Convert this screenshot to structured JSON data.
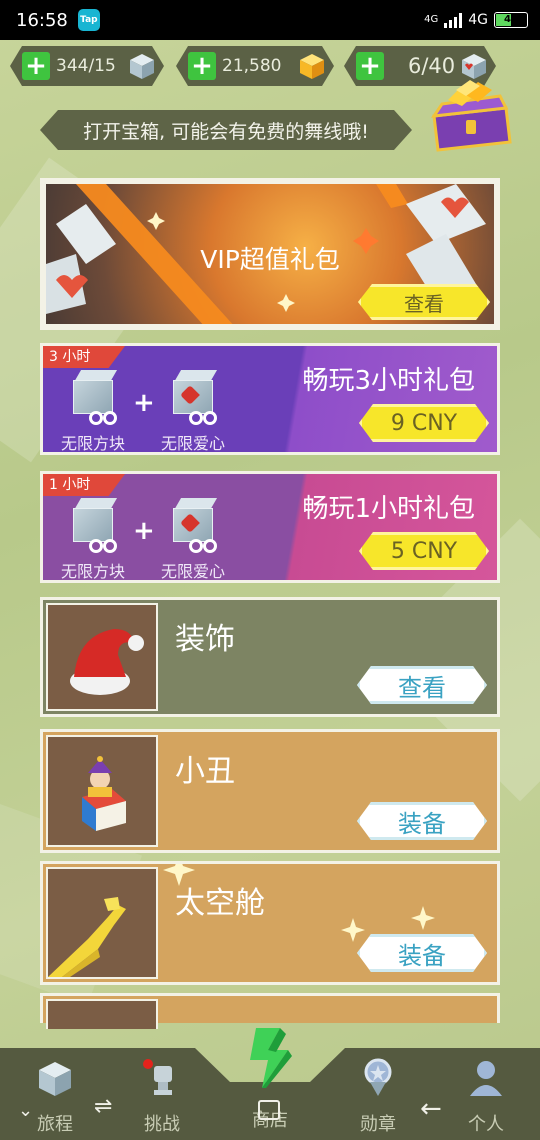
{
  "status_bar": {
    "time": "16:58",
    "app_icon_text": "Tap",
    "network_small": "4G",
    "network": "4G",
    "battery": "49"
  },
  "resources": [
    {
      "value": "344/15",
      "icon": "blue-cube-icon"
    },
    {
      "value": "21,580",
      "icon": "gold-cube-icon"
    },
    {
      "value": "6/40",
      "icon": "heart-cube-icon"
    }
  ],
  "tip": {
    "text": "打开宝箱, 可能会有免费的舞线哦!"
  },
  "vip": {
    "title": "VIP超值礼包",
    "button": "查看"
  },
  "packs": [
    {
      "tag": "3 小时",
      "title": "畅玩3小时礼包",
      "item1": "无限方块",
      "item2": "无限爱心",
      "price": "9 CNY"
    },
    {
      "tag": "1 小时",
      "title": "畅玩1小时礼包",
      "item1": "无限方块",
      "item2": "无限爱心",
      "price": "5 CNY"
    }
  ],
  "items": [
    {
      "title": "装饰",
      "button": "查看"
    },
    {
      "title": "小丑",
      "button": "装备"
    },
    {
      "title": "太空舱",
      "button": "装备"
    }
  ],
  "partial_item_title": "",
  "bottom_nav": [
    {
      "label": "旅程",
      "icon": "house-cube-icon"
    },
    {
      "label": "挑战",
      "icon": "trophy-icon"
    },
    {
      "label": "商店",
      "icon": "store-icon"
    },
    {
      "label": "勋章",
      "icon": "medal-icon"
    },
    {
      "label": "个人",
      "icon": "person-icon"
    }
  ],
  "colors": {
    "background": "#c3d197",
    "accent_yellow": "#f7e62a",
    "plus_green": "#3fc43f",
    "button_text_blue": "#3aa2c2"
  }
}
